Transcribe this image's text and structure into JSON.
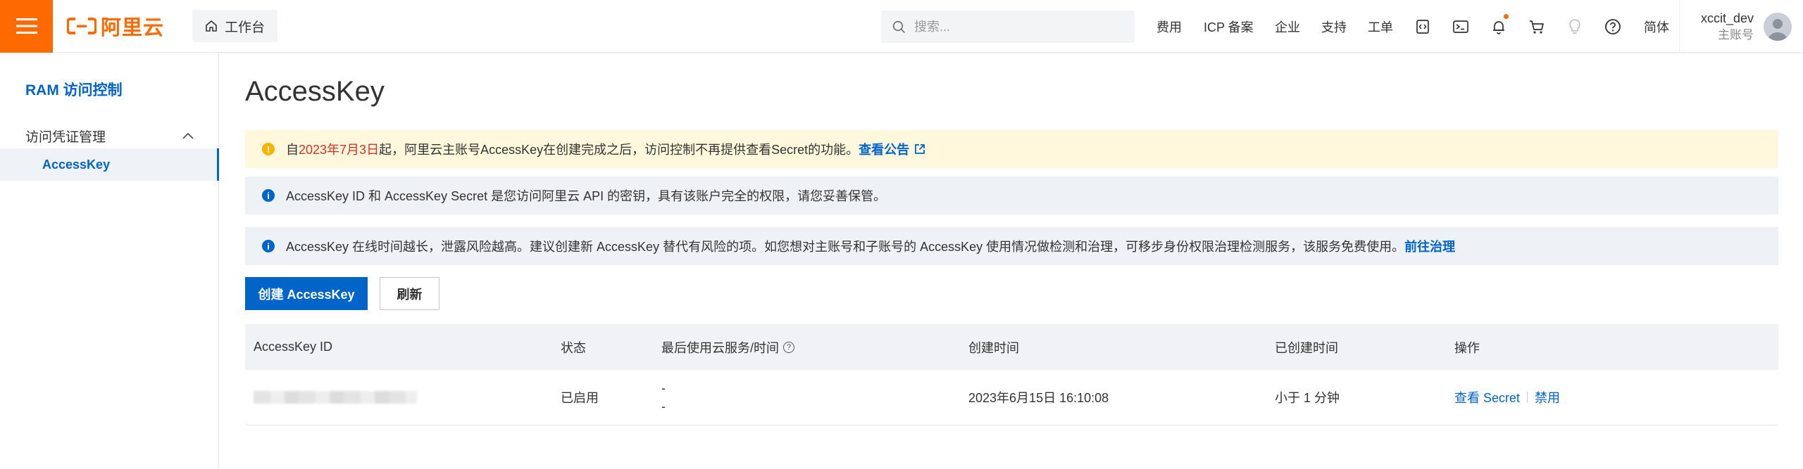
{
  "topbar": {
    "brand": "阿里云",
    "workbench_label": "工作台",
    "search_placeholder": "搜索...",
    "links": {
      "billing": "费用",
      "icp": "ICP 备案",
      "enterprise": "企业",
      "support": "支持",
      "ticket": "工单",
      "language": "简体"
    },
    "user": {
      "name": "xccit_dev",
      "role": "主账号"
    },
    "brand_color": "#ff6a00"
  },
  "sidebar": {
    "title": "RAM 访问控制",
    "group_label": "访问凭证管理",
    "items": [
      {
        "label": "AccessKey",
        "active": true
      }
    ]
  },
  "main": {
    "title": "AccessKey",
    "banners": {
      "warning": {
        "prefix": "自",
        "date": "2023年7月3日",
        "text": "起，阿里云主账号AccessKey在创建完成之后，访问控制不再提供查看Secret的功能。",
        "link": "查看公告"
      },
      "info1": {
        "text": "AccessKey ID 和 AccessKey Secret 是您访问阿里云 API 的密钥，具有该账户完全的权限，请您妥善保管。"
      },
      "info2": {
        "text": "AccessKey 在线时间越长，泄露风险越高。建议创建新 AccessKey 替代有风险的项。如您想对主账号和子账号的 AccessKey 使用情况做检测和治理，可移步身份权限治理检测服务，该服务免费使用。",
        "link": "前往治理"
      }
    },
    "buttons": {
      "create": "创建 AccessKey",
      "refresh": "刷新"
    },
    "table": {
      "headers": [
        "AccessKey ID",
        "状态",
        "最后使用云服务/时间",
        "创建时间",
        "已创建时间",
        "操作"
      ],
      "rows": [
        {
          "status": "已启用",
          "last_service": "-",
          "last_time": "-",
          "created_at": "2023年6月15日 16:10:08",
          "age": "小于 1 分钟",
          "action_view": "查看 Secret",
          "action_disable": "禁用"
        }
      ]
    }
  },
  "colors": {
    "primary": "#0064c8",
    "warning_bg": "#fff8dd",
    "warning_icon": "#f5b400",
    "info_bg": "#eef1f5",
    "highlight_red": "#d93026"
  }
}
